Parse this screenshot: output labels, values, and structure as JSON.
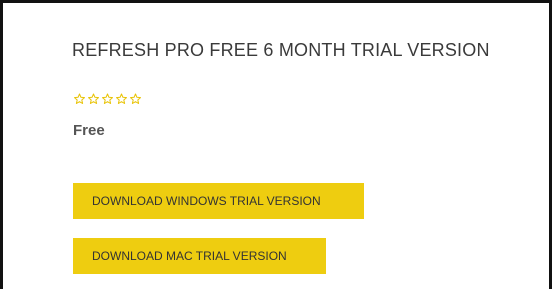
{
  "product": {
    "title": "REFRESH PRO FREE 6 MONTH TRIAL VERSION",
    "price": "Free",
    "rating": {
      "stars_filled": 0,
      "stars_total": 5,
      "star_color": "#e8c200",
      "icon": "star-outline-icon"
    }
  },
  "actions": {
    "download_windows_label": "DOWNLOAD WINDOWS TRIAL VERSION",
    "download_mac_label": "DOWNLOAD MAC TRIAL VERSION",
    "button_color": "#eecd10"
  }
}
